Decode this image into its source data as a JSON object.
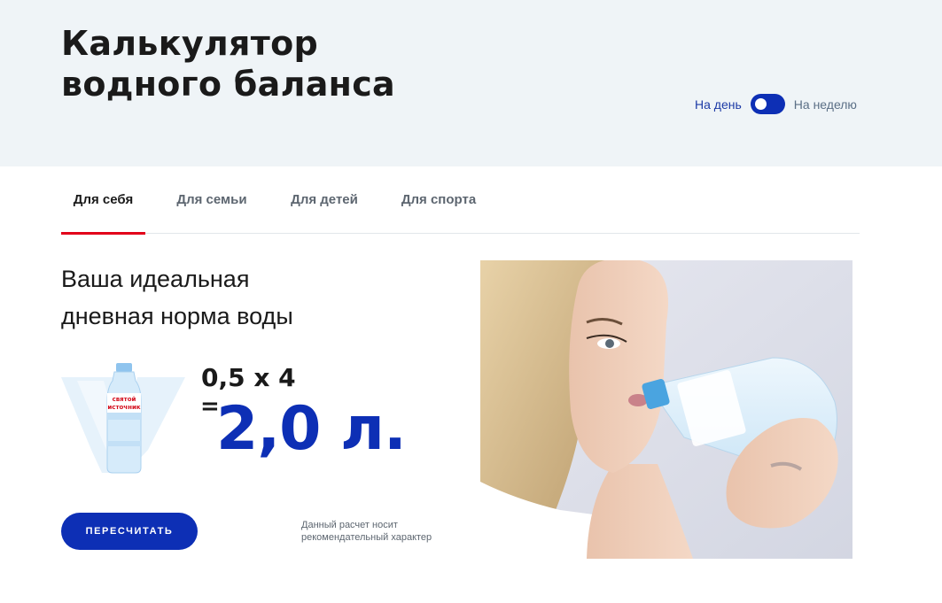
{
  "header": {
    "title_line1": "Калькулятор",
    "title_line2": "водного баланса",
    "period_toggle": {
      "day_label": "На день",
      "week_label": "На неделю",
      "selected": "На день"
    }
  },
  "tabs": [
    {
      "label": "Для себя",
      "active": true
    },
    {
      "label": "Для семьи",
      "active": false
    },
    {
      "label": "Для детей",
      "active": false
    },
    {
      "label": "Для спорта",
      "active": false
    }
  ],
  "result": {
    "heading_line1": "Ваша идеальная",
    "heading_line2": "дневная норма воды",
    "formula": "0,5 x 4",
    "equals": "=",
    "total": "2,0 л."
  },
  "bottle": {
    "brand_line1": "святой",
    "brand_line2": "источник"
  },
  "actions": {
    "recalculate_label": "ПЕРЕСЧИТАТЬ"
  },
  "disclaimer": {
    "line1": "Данный расчет носит",
    "line2": "рекомендательный характер"
  },
  "colors": {
    "accent": "#0d2fb5",
    "tab_underline": "#e2001a",
    "hero_bg": "#eff4f7"
  }
}
